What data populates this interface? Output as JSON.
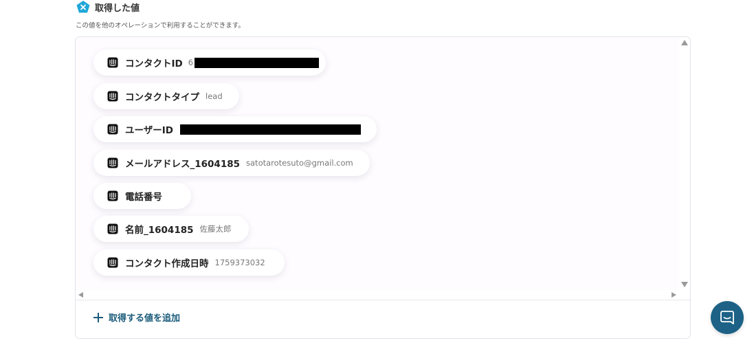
{
  "header": {
    "icon": "pentagon-x-icon",
    "title": "取得した値",
    "subtitle": "この値を他のオペレーションで利用することができます。",
    "accent_color": "#1fa7d8"
  },
  "values": [
    {
      "label": "コンタクトID",
      "value": "6",
      "redacted": true
    },
    {
      "label": "コンタクトタイプ",
      "value": "lead",
      "redacted": false
    },
    {
      "label": "ユーザーID",
      "value": "",
      "redacted": true
    },
    {
      "label": "メールアドレス_1604185",
      "value": "satotarotesuto@gmail.com",
      "redacted": false
    },
    {
      "label": "電話番号",
      "value": "",
      "redacted": false
    },
    {
      "label": "名前_1604185",
      "value": "佐藤太郎",
      "redacted": false
    },
    {
      "label": "コンタクト作成日時",
      "value": "1759373032",
      "redacted": false
    }
  ],
  "add_button": {
    "label": "取得する値を追加",
    "color": "#1a5b7a"
  },
  "chat_button": {
    "icon": "chat-bubble-icon",
    "color": "#1d6286"
  }
}
